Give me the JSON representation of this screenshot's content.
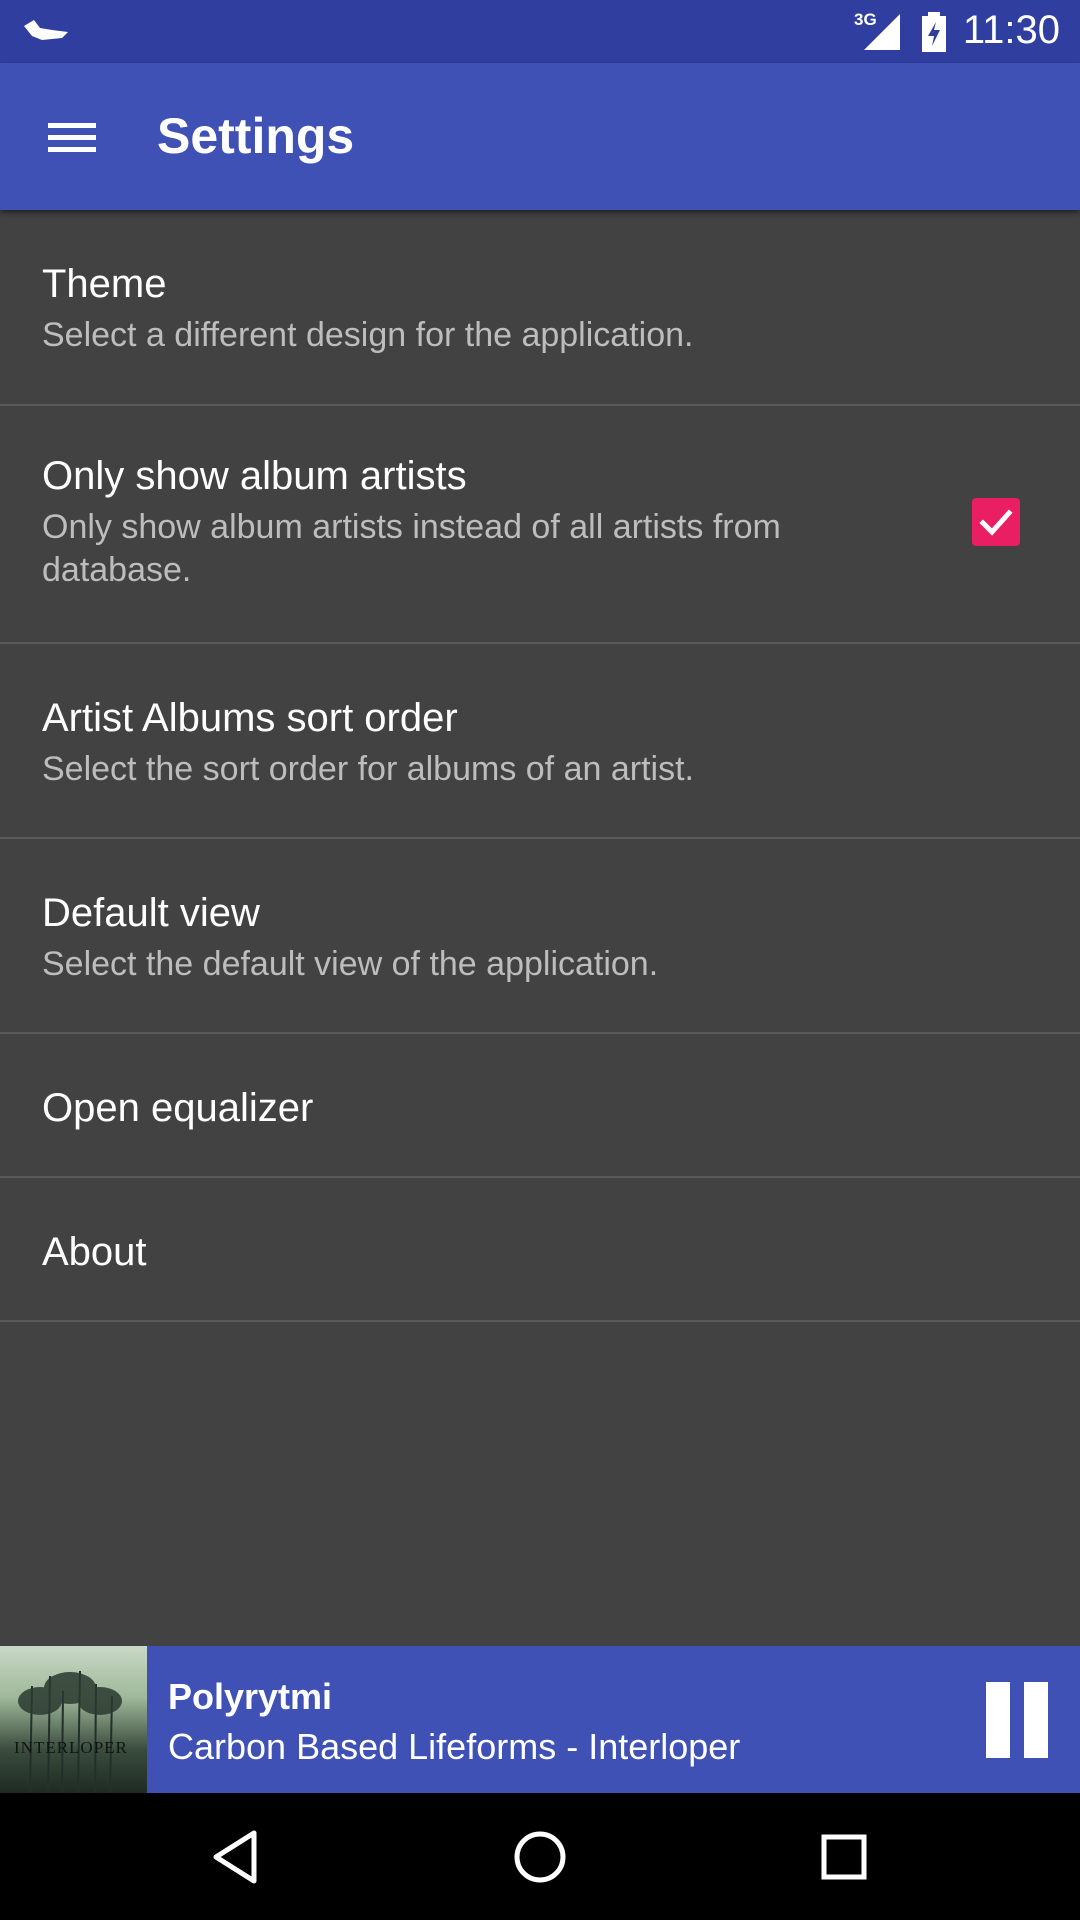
{
  "status_bar": {
    "network": "3G",
    "time": "11:30",
    "icons": [
      "bird-notification-icon",
      "signal-icon",
      "battery-charging-icon"
    ]
  },
  "app_bar": {
    "title": "Settings",
    "menu_icon": "hamburger-menu-icon"
  },
  "settings": {
    "items": [
      {
        "title": "Theme",
        "summary": "Select a different design for the application."
      },
      {
        "title": "Only show album artists",
        "summary": "Only show album artists instead of all artists from database.",
        "checked": true
      },
      {
        "title": "Artist Albums sort order",
        "summary": "Select the sort order for albums of an artist."
      },
      {
        "title": "Default view",
        "summary": "Select the default view of the application."
      },
      {
        "title": "Open equalizer"
      },
      {
        "title": "About"
      }
    ]
  },
  "now_playing": {
    "track": "Polyrytmi",
    "artist_album": "Carbon Based Lifeforms - Interloper",
    "cover_text": "INTERLOPER",
    "control_icon": "pause-icon"
  },
  "nav_bar": {
    "icons": [
      "back-icon",
      "home-icon",
      "recents-icon"
    ]
  },
  "colors": {
    "status_bar": "#303F9F",
    "app_bar": "#3F51B5",
    "background": "#424242",
    "checkbox": "#E91E63"
  }
}
